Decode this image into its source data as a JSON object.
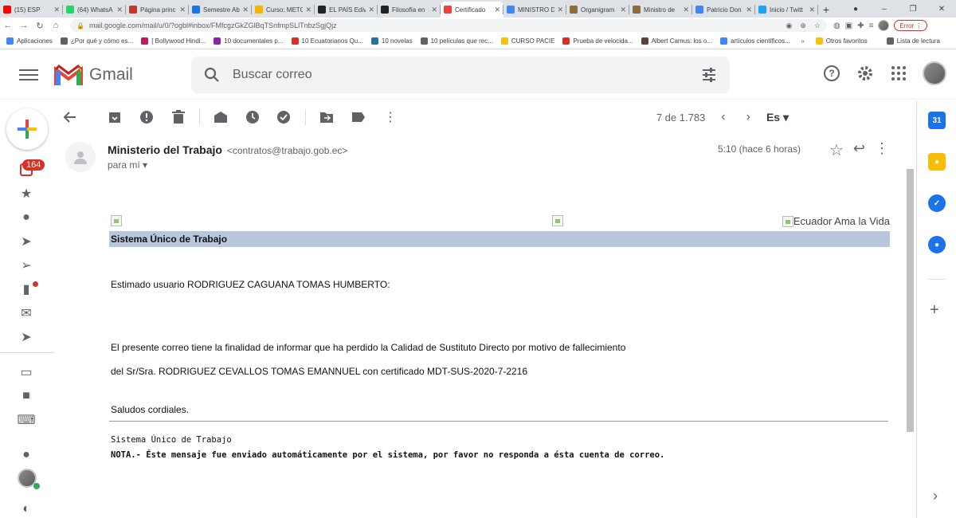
{
  "browser": {
    "tabs": [
      {
        "title": "(15) ESP",
        "color": "#ff0000"
      },
      {
        "title": "(64) WhatsA",
        "color": "#25d366"
      },
      {
        "title": "Página princ",
        "color": "#c0392b"
      },
      {
        "title": "Semestre Ab",
        "color": "#1a73e8"
      },
      {
        "title": "Curso: METC",
        "color": "#f4b400"
      },
      {
        "title": "EL PAÍS Ediv",
        "color": "#222222"
      },
      {
        "title": "Filosofía en",
        "color": "#222222"
      },
      {
        "title": "Certificado",
        "color": "#ea4335"
      },
      {
        "title": "MINISTRO D",
        "color": "#4285f4"
      },
      {
        "title": "Organigram",
        "color": "#8a6d3b"
      },
      {
        "title": "Ministro de",
        "color": "#8a6d3b"
      },
      {
        "title": "Patricio Don",
        "color": "#4285f4"
      },
      {
        "title": "Inicio / Twitt",
        "color": "#1da1f2"
      }
    ],
    "url": "mail.google.com/mail/u/0/?ogbl#inbox/FMfcgzGkZGlBqTSnfmpSLlTnbzSgjQjz",
    "error_label": "Error",
    "bookmarks": [
      {
        "label": "Aplicaciones",
        "color": "#4285f4"
      },
      {
        "label": "¿Por qué y cómo es...",
        "color": "#5f6368"
      },
      {
        "label": "[ Bollywood Hindi...",
        "color": "#c2185b"
      },
      {
        "label": "10 documentales p...",
        "color": "#8e24aa"
      },
      {
        "label": "10 Ecuatorianos Qu...",
        "color": "#d93025"
      },
      {
        "label": "10 novelas",
        "color": "#21759b"
      },
      {
        "label": "10 películas que rec...",
        "color": "#5f6368"
      },
      {
        "label": "CURSO PACIE",
        "color": "#f4c20d"
      },
      {
        "label": "Prueba de velocida...",
        "color": "#d93025"
      },
      {
        "label": "Albert Camus: los o...",
        "color": "#5d4037"
      },
      {
        "label": "artículos científicos...",
        "color": "#4285f4"
      }
    ],
    "other_favs": "Otros favoritos",
    "reading_list": "Lista de lectura"
  },
  "gmail": {
    "logo_text": "Gmail",
    "search_placeholder": "Buscar correo",
    "unread_count": "164",
    "pager": "7 de 1.783",
    "lang": "Es"
  },
  "message": {
    "sender_name": "Ministerio del Trabajo",
    "sender_email": "<contratos@trabajo.gob.ec>",
    "to": "para mí",
    "time": "5:10 (hace 6 horas)",
    "img_alt": "Ecuador Ama la Vida",
    "system_title": "Sistema Único de Trabajo",
    "greeting": "Estimado usuario RODRIGUEZ CAGUANA TOMAS HUMBERTO:",
    "line1": "El presente correo tiene la finalidad de informar que ha perdido la Calidad de Sustituto Directo por motivo de fallecimiento",
    "line2": "del Sr/Sra. RODRIGUEZ CEVALLOS TOMAS EMANNUEL con certificado MDT-SUS-2020-7-2216",
    "closing": "Saludos cordiales.",
    "footer_system": "Sistema Único de Trabajo",
    "footer_note": "NOTA.- Éste mensaje fue enviado automáticamente por el sistema, por favor no responda a ésta cuenta de correo."
  },
  "right_panel": {
    "calendar_day": "31"
  }
}
